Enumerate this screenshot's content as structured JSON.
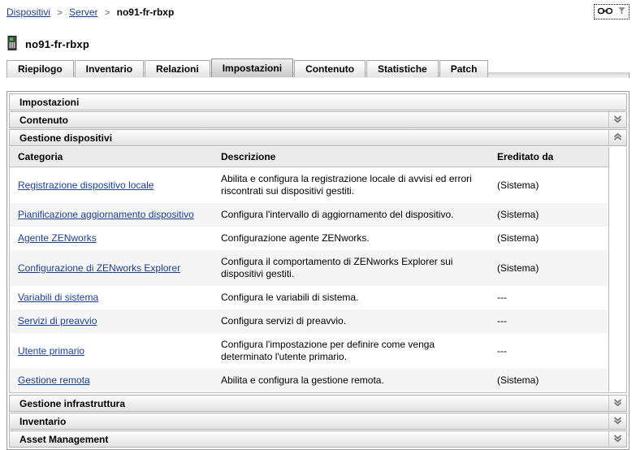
{
  "breadcrumb": {
    "items": [
      {
        "label": "Dispositivi",
        "link": true
      },
      {
        "label": "Server",
        "link": true
      },
      {
        "label": "no91-fr-rbxp",
        "link": false
      }
    ],
    "separator": ">"
  },
  "toolbox": {
    "link_icon": "chain-link-icon",
    "filter_icon": "funnel-icon"
  },
  "page": {
    "icon": "server-device-icon",
    "title": "no91-fr-rbxp"
  },
  "tabs": [
    {
      "label": "Riepilogo",
      "active": false
    },
    {
      "label": "Inventario",
      "active": false
    },
    {
      "label": "Relazioni",
      "active": false
    },
    {
      "label": "Impostazioni",
      "active": true
    },
    {
      "label": "Contenuto",
      "active": false
    },
    {
      "label": "Statistiche",
      "active": false
    },
    {
      "label": "Patch",
      "active": false
    }
  ],
  "panel": {
    "title": "Impostazioni",
    "sections": [
      {
        "label": "Contenuto",
        "expanded": false,
        "toggle_icon": "chevron-double-down-icon"
      },
      {
        "label": "Gestione dispositivi",
        "expanded": true,
        "toggle_icon": "chevron-double-up-icon"
      }
    ],
    "bottom_sections": [
      {
        "label": "Gestione infrastruttura",
        "expanded": false,
        "toggle_icon": "chevron-double-down-icon"
      },
      {
        "label": "Inventario",
        "expanded": false,
        "toggle_icon": "chevron-double-down-icon"
      },
      {
        "label": "Asset Management",
        "expanded": false,
        "toggle_icon": "chevron-double-down-icon"
      }
    ]
  },
  "table": {
    "columns": [
      "Categoria",
      "Descrizione",
      "Ereditato da"
    ],
    "rows": [
      {
        "category": "Registrazione dispositivo locale",
        "description": "Abilita e configura la registrazione locale di avvisi ed errori riscontrati sui dispositivi gestiti.",
        "inherited_from": "(Sistema)"
      },
      {
        "category": "Pianificazione aggiornamento dispositivo",
        "description": "Configura l'intervallo di aggiornamento del dispositivo.",
        "inherited_from": "(Sistema)"
      },
      {
        "category": "Agente ZENworks",
        "description": "Configurazione agente ZENworks.",
        "inherited_from": "(Sistema)"
      },
      {
        "category": "Configurazione di ZENworks Explorer",
        "description": "Configura il comportamento di ZENworks Explorer sui dispositivi gestiti.",
        "inherited_from": "(Sistema)"
      },
      {
        "category": "Variabili di sistema",
        "description": "Configura le variabili di sistema.",
        "inherited_from": "---"
      },
      {
        "category": "Servizi di preavvio",
        "description": "Configura servizi di preavvio.",
        "inherited_from": "---"
      },
      {
        "category": "Utente primario",
        "description": "Configura l'impostazione per definire come venga determinato l'utente primario.",
        "inherited_from": "---"
      },
      {
        "category": "Gestione remota",
        "description": "Abilita e configura la gestione remota.",
        "inherited_from": "(Sistema)"
      }
    ]
  },
  "colors": {
    "link": "#1b3f94",
    "panel_border": "#9a9a9a",
    "header_bg": "#ebebeb",
    "row_alt": "#f5f5f5",
    "status_led": "#33cc33"
  }
}
